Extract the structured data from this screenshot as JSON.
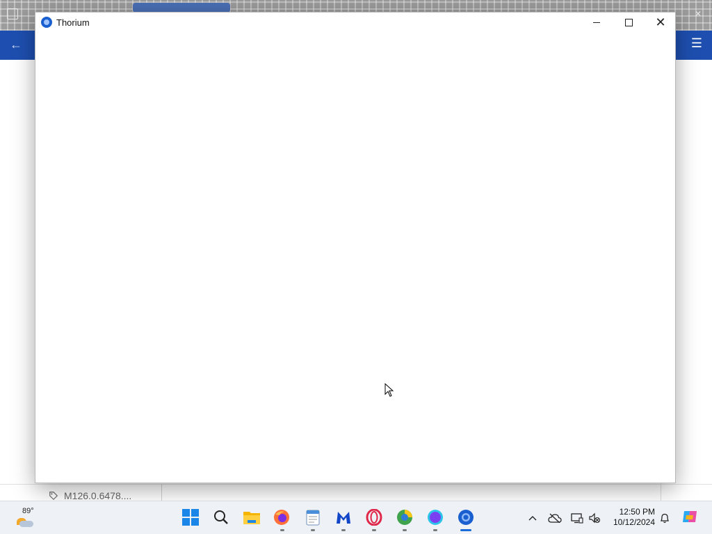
{
  "background": {
    "version_label": "M126.0.6478...."
  },
  "window": {
    "title": "Thorium",
    "controls": {
      "minimize": "minimize",
      "maximize": "maximize",
      "close": "close"
    }
  },
  "taskbar": {
    "weather": {
      "temperature": "89°",
      "icon": "partly-cloudy-icon"
    },
    "pinned_apps": [
      {
        "name": "start",
        "icon": "windows-logo-icon"
      },
      {
        "name": "search",
        "icon": "search-icon"
      },
      {
        "name": "file-explorer",
        "icon": "folder-icon"
      },
      {
        "name": "firefox",
        "icon": "firefox-icon"
      },
      {
        "name": "notepad",
        "icon": "notepad-icon"
      },
      {
        "name": "malwarebytes",
        "icon": "malwarebytes-icon"
      },
      {
        "name": "opera",
        "icon": "opera-icon"
      },
      {
        "name": "browser",
        "icon": "browser-icon"
      },
      {
        "name": "app",
        "icon": "purple-circle-icon"
      },
      {
        "name": "thorium",
        "icon": "thorium-icon",
        "active": true
      }
    ],
    "clock": {
      "time": "12:50 PM",
      "date": "10/12/2024"
    }
  },
  "colors": {
    "accent_blue": "#1e4fb0",
    "taskbar_bg": "#eef1f5",
    "active_indicator": "#1a6ad8"
  }
}
